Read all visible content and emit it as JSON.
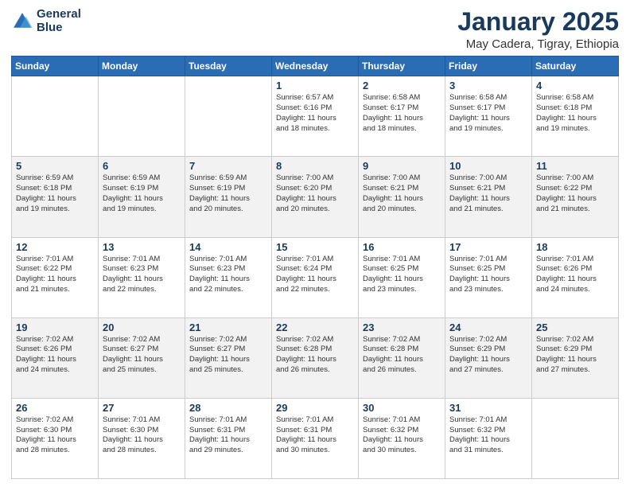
{
  "logo": {
    "line1": "General",
    "line2": "Blue"
  },
  "title": "January 2025",
  "location": "May Cadera, Tigray, Ethiopia",
  "weekdays": [
    "Sunday",
    "Monday",
    "Tuesday",
    "Wednesday",
    "Thursday",
    "Friday",
    "Saturday"
  ],
  "weeks": [
    [
      {
        "day": "",
        "info": ""
      },
      {
        "day": "",
        "info": ""
      },
      {
        "day": "",
        "info": ""
      },
      {
        "day": "1",
        "info": "Sunrise: 6:57 AM\nSunset: 6:16 PM\nDaylight: 11 hours\nand 18 minutes."
      },
      {
        "day": "2",
        "info": "Sunrise: 6:58 AM\nSunset: 6:17 PM\nDaylight: 11 hours\nand 18 minutes."
      },
      {
        "day": "3",
        "info": "Sunrise: 6:58 AM\nSunset: 6:17 PM\nDaylight: 11 hours\nand 19 minutes."
      },
      {
        "day": "4",
        "info": "Sunrise: 6:58 AM\nSunset: 6:18 PM\nDaylight: 11 hours\nand 19 minutes."
      }
    ],
    [
      {
        "day": "5",
        "info": "Sunrise: 6:59 AM\nSunset: 6:18 PM\nDaylight: 11 hours\nand 19 minutes."
      },
      {
        "day": "6",
        "info": "Sunrise: 6:59 AM\nSunset: 6:19 PM\nDaylight: 11 hours\nand 19 minutes."
      },
      {
        "day": "7",
        "info": "Sunrise: 6:59 AM\nSunset: 6:19 PM\nDaylight: 11 hours\nand 20 minutes."
      },
      {
        "day": "8",
        "info": "Sunrise: 7:00 AM\nSunset: 6:20 PM\nDaylight: 11 hours\nand 20 minutes."
      },
      {
        "day": "9",
        "info": "Sunrise: 7:00 AM\nSunset: 6:21 PM\nDaylight: 11 hours\nand 20 minutes."
      },
      {
        "day": "10",
        "info": "Sunrise: 7:00 AM\nSunset: 6:21 PM\nDaylight: 11 hours\nand 21 minutes."
      },
      {
        "day": "11",
        "info": "Sunrise: 7:00 AM\nSunset: 6:22 PM\nDaylight: 11 hours\nand 21 minutes."
      }
    ],
    [
      {
        "day": "12",
        "info": "Sunrise: 7:01 AM\nSunset: 6:22 PM\nDaylight: 11 hours\nand 21 minutes."
      },
      {
        "day": "13",
        "info": "Sunrise: 7:01 AM\nSunset: 6:23 PM\nDaylight: 11 hours\nand 22 minutes."
      },
      {
        "day": "14",
        "info": "Sunrise: 7:01 AM\nSunset: 6:23 PM\nDaylight: 11 hours\nand 22 minutes."
      },
      {
        "day": "15",
        "info": "Sunrise: 7:01 AM\nSunset: 6:24 PM\nDaylight: 11 hours\nand 22 minutes."
      },
      {
        "day": "16",
        "info": "Sunrise: 7:01 AM\nSunset: 6:25 PM\nDaylight: 11 hours\nand 23 minutes."
      },
      {
        "day": "17",
        "info": "Sunrise: 7:01 AM\nSunset: 6:25 PM\nDaylight: 11 hours\nand 23 minutes."
      },
      {
        "day": "18",
        "info": "Sunrise: 7:01 AM\nSunset: 6:26 PM\nDaylight: 11 hours\nand 24 minutes."
      }
    ],
    [
      {
        "day": "19",
        "info": "Sunrise: 7:02 AM\nSunset: 6:26 PM\nDaylight: 11 hours\nand 24 minutes."
      },
      {
        "day": "20",
        "info": "Sunrise: 7:02 AM\nSunset: 6:27 PM\nDaylight: 11 hours\nand 25 minutes."
      },
      {
        "day": "21",
        "info": "Sunrise: 7:02 AM\nSunset: 6:27 PM\nDaylight: 11 hours\nand 25 minutes."
      },
      {
        "day": "22",
        "info": "Sunrise: 7:02 AM\nSunset: 6:28 PM\nDaylight: 11 hours\nand 26 minutes."
      },
      {
        "day": "23",
        "info": "Sunrise: 7:02 AM\nSunset: 6:28 PM\nDaylight: 11 hours\nand 26 minutes."
      },
      {
        "day": "24",
        "info": "Sunrise: 7:02 AM\nSunset: 6:29 PM\nDaylight: 11 hours\nand 27 minutes."
      },
      {
        "day": "25",
        "info": "Sunrise: 7:02 AM\nSunset: 6:29 PM\nDaylight: 11 hours\nand 27 minutes."
      }
    ],
    [
      {
        "day": "26",
        "info": "Sunrise: 7:02 AM\nSunset: 6:30 PM\nDaylight: 11 hours\nand 28 minutes."
      },
      {
        "day": "27",
        "info": "Sunrise: 7:01 AM\nSunset: 6:30 PM\nDaylight: 11 hours\nand 28 minutes."
      },
      {
        "day": "28",
        "info": "Sunrise: 7:01 AM\nSunset: 6:31 PM\nDaylight: 11 hours\nand 29 minutes."
      },
      {
        "day": "29",
        "info": "Sunrise: 7:01 AM\nSunset: 6:31 PM\nDaylight: 11 hours\nand 30 minutes."
      },
      {
        "day": "30",
        "info": "Sunrise: 7:01 AM\nSunset: 6:32 PM\nDaylight: 11 hours\nand 30 minutes."
      },
      {
        "day": "31",
        "info": "Sunrise: 7:01 AM\nSunset: 6:32 PM\nDaylight: 11 hours\nand 31 minutes."
      },
      {
        "day": "",
        "info": ""
      }
    ]
  ]
}
